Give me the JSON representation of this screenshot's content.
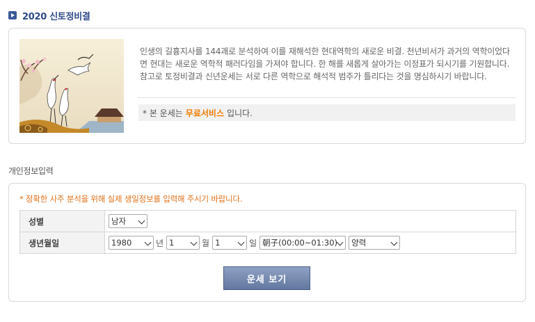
{
  "page": {
    "title": "2020 신토정비결"
  },
  "intro": {
    "paragraph": "인생의 길흉지사를 144괘로 분석하여 이를 재해석한 현대역학의 새로운 비결. 천년비서가 과거의 역학이었다면 현대는 새로운 역학적 패러다임을 가져야 합니다. 한 해를 새롭게 살아가는 이정표가 되시기를 기원합니다. 참고로 토정비결과 신년운세는 서로 다른 역학으로 해석적 범주가 틀리다는 것을 명심하시기 바랍니다.",
    "notice_prefix": "* 본 운세는",
    "notice_highlight": "무료서비스",
    "notice_suffix": "입니다."
  },
  "section_label": "개인정보입력",
  "form": {
    "note": "* 정확한 사주 분석을 위해 실제 생일정보를 입력해 주시기 바랍니다.",
    "gender": {
      "label": "성별",
      "value": "남자"
    },
    "birth": {
      "label": "생년월일",
      "year_value": "1980",
      "year_unit": "년",
      "month_value": "1",
      "month_unit": "월",
      "day_value": "1",
      "day_unit": "일",
      "hour_value": "朝子(00:00~01:30)",
      "calendar_value": "양력"
    },
    "submit_label": "운세 보기"
  },
  "colors": {
    "title": "#2f4a8a",
    "accent_orange": "#f07b00",
    "note_orange": "#e0711a",
    "button": "#6f83a9"
  }
}
